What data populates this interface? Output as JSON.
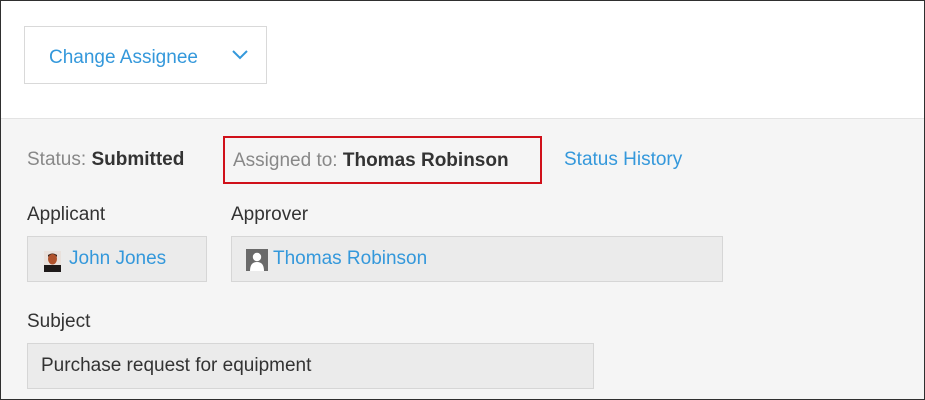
{
  "toolbar": {
    "change_assignee_label": "Change Assignee",
    "chevron_icon": "chevron-down-icon"
  },
  "status": {
    "label": "Status:",
    "value": "Submitted",
    "assigned_label": "Assigned to:",
    "assigned_value": "Thomas Robinson",
    "history_link": "Status History",
    "highlight_color": "#d0101a"
  },
  "applicant": {
    "label": "Applicant",
    "name": "John Jones",
    "avatar_icon": "user-photo-icon"
  },
  "approver": {
    "label": "Approver",
    "name": "Thomas Robinson",
    "avatar_icon": "default-user-icon"
  },
  "subject": {
    "label": "Subject",
    "value": "Purchase request for equipment"
  },
  "colors": {
    "link": "#3498db",
    "panel_bg": "#f5f5f5"
  }
}
